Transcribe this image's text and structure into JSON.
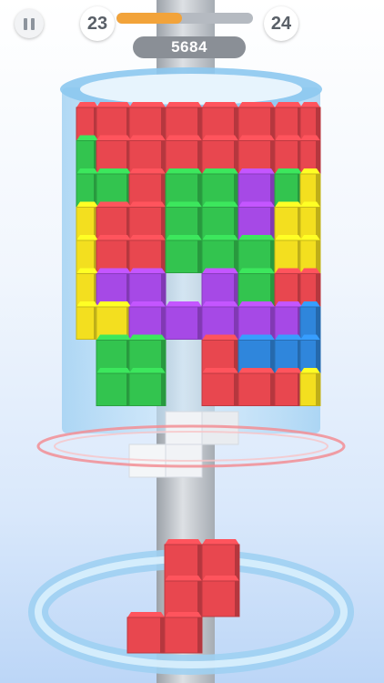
{
  "hud": {
    "current_level": "23",
    "next_level": "24",
    "level_progress": 0.48,
    "score": "5684"
  },
  "icons": {
    "pause": "pause-icon"
  },
  "colors": {
    "red": "#e8474f",
    "green": "#33c44f",
    "purple": "#a649e6",
    "yellow": "#f3df1f",
    "blue": "#2f86dc",
    "white": "#f1f3f6",
    "progress": "#f2a33a"
  },
  "tower": {
    "rows": [
      [
        "red",
        "red",
        "red",
        "red",
        "red",
        "red",
        "red",
        "red"
      ],
      [
        "green",
        "red",
        "red",
        "red",
        "red",
        "red",
        "red",
        "red"
      ],
      [
        "green",
        "green",
        "red",
        "green",
        "green",
        "purple",
        "green",
        "yellow"
      ],
      [
        "yellow",
        "red",
        "red",
        "green",
        "green",
        "purple",
        "yellow",
        "yellow"
      ],
      [
        "yellow",
        "red",
        "red",
        "green",
        "green",
        "green",
        "yellow",
        "yellow"
      ],
      [
        "yellow",
        "purple",
        "purple",
        "empty",
        "purple",
        "green",
        "red",
        "red"
      ],
      [
        "yellow",
        "yellow",
        "purple",
        "purple",
        "purple",
        "purple",
        "purple",
        "blue"
      ],
      [
        "empty",
        "green",
        "green",
        "empty",
        "red",
        "blue",
        "blue",
        "blue"
      ],
      [
        "empty",
        "green",
        "green",
        "empty",
        "red",
        "red",
        "red",
        "yellow"
      ]
    ]
  },
  "falling_piece": {
    "color": "red",
    "cells": [
      [
        1,
        0
      ],
      [
        2,
        0
      ],
      [
        1,
        1
      ],
      [
        2,
        1
      ],
      [
        0,
        2
      ],
      [
        1,
        2
      ]
    ]
  }
}
